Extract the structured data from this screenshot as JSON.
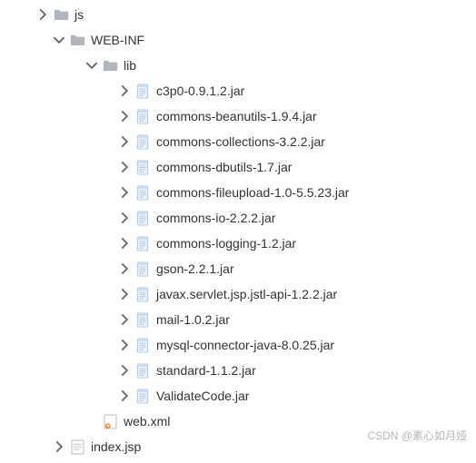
{
  "watermark": "CSDN @素心如月娅",
  "tree": {
    "js": {
      "label": "js"
    },
    "webinf": {
      "label": "WEB-INF"
    },
    "lib": {
      "label": "lib"
    },
    "jars": [
      "c3p0-0.9.1.2.jar",
      "commons-beanutils-1.9.4.jar",
      "commons-collections-3.2.2.jar",
      "commons-dbutils-1.7.jar",
      "commons-fileupload-1.0-5.5.23.jar",
      "commons-io-2.2.2.jar",
      "commons-logging-1.2.jar",
      "gson-2.2.1.jar",
      "javax.servlet.jsp.jstl-api-1.2.2.jar",
      "mail-1.0.2.jar",
      "mysql-connector-java-8.0.25.jar",
      "standard-1.1.2.jar",
      "ValidateCode.jar"
    ],
    "webxml": "web.xml",
    "indexjsp": "index.jsp"
  },
  "indent": {
    "d1": 40,
    "d2": 58,
    "d3": 94,
    "d4": 130,
    "d3file": 112
  }
}
